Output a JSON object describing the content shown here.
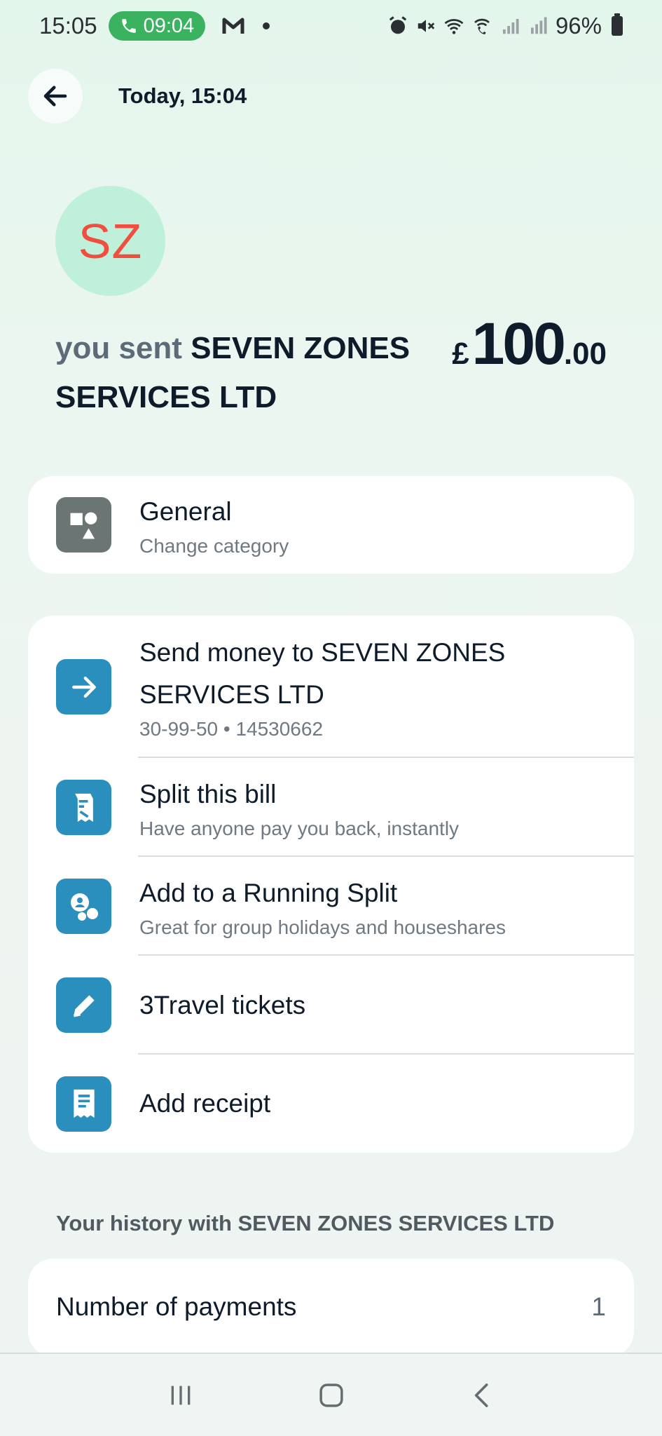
{
  "status_bar": {
    "time": "15:05",
    "call_timer": "09:04",
    "battery": "96%"
  },
  "header": {
    "title": "Today, 15:04"
  },
  "avatar": {
    "initials": "SZ",
    "bg_color": "#bff0d9",
    "text_color": "#f04e3e"
  },
  "transaction": {
    "prefix": "you sent",
    "payee": "SEVEN ZONES SERVICES LTD",
    "currency": "£",
    "amount_whole": "100",
    "amount_decimal": ".00"
  },
  "category": {
    "title": "General",
    "subtitle": "Change category",
    "icon": "shapes-icon"
  },
  "actions": [
    {
      "title": "Send money to SEVEN ZONES SERVICES LTD",
      "subtitle": "30-99-50 • 14530662",
      "icon": "arrow-right-icon"
    },
    {
      "title": "Split this bill",
      "subtitle": "Have anyone pay you back, instantly",
      "icon": "split-bill-icon"
    },
    {
      "title": "Add to a Running Split",
      "subtitle": "Great for group holidays and houseshares",
      "icon": "running-split-icon"
    },
    {
      "title": "3Travel tickets",
      "subtitle": "",
      "icon": "pencil-icon"
    },
    {
      "title": "Add receipt",
      "subtitle": "",
      "icon": "receipt-icon"
    }
  ],
  "history": {
    "heading": "Your history with SEVEN ZONES SERVICES LTD",
    "rows": [
      {
        "label": "Number of payments",
        "value": "1"
      }
    ]
  },
  "colors": {
    "accent_blue": "#2a8fbd",
    "category_grey": "#6b7573",
    "call_green": "#3bb25f"
  }
}
